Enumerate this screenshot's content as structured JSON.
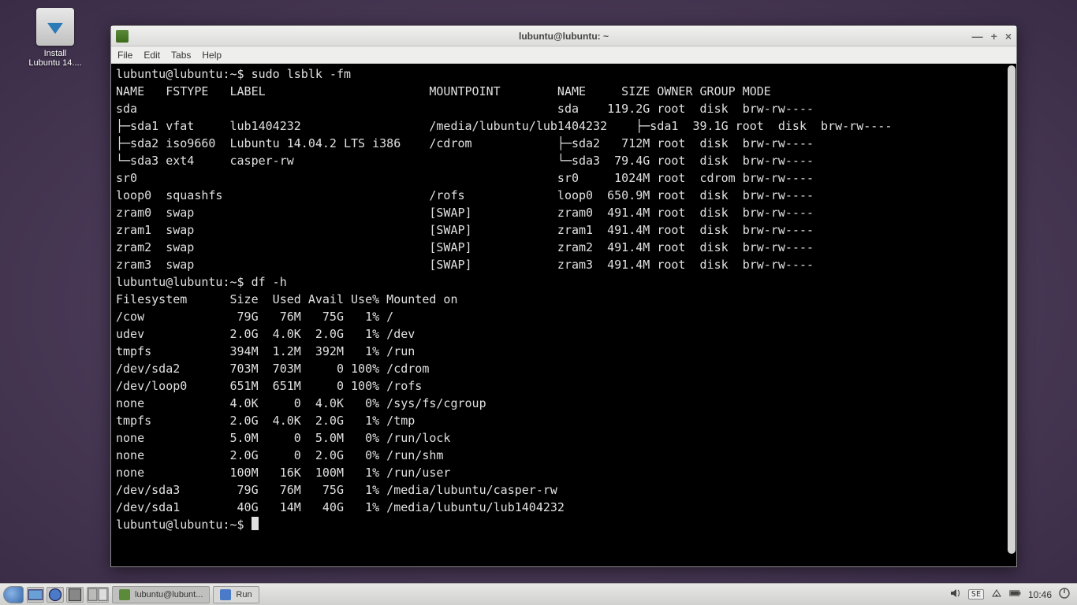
{
  "desktop_icon": {
    "label": "Install\nLubuntu 14...."
  },
  "window": {
    "title": "lubuntu@lubuntu: ~",
    "menus": [
      "File",
      "Edit",
      "Tabs",
      "Help"
    ]
  },
  "terminal": {
    "prompt": "lubuntu@lubuntu:~$",
    "cmd1": "sudo lsblk -fm",
    "lsblk_header_left": "NAME   FSTYPE   LABEL                       MOUNTPOINT",
    "lsblk_header_right": "NAME     SIZE OWNER GROUP MODE",
    "lsblk_rows": [
      {
        "l": "sda",
        "r": "sda    119.2G root  disk  brw-rw----"
      },
      {
        "l": "├─sda1 vfat     lub1404232                  /media/lubuntu/lub1404232",
        "r": "├─sda1  39.1G root  disk  brw-rw----"
      },
      {
        "l": "├─sda2 iso9660  Lubuntu 14.04.2 LTS i386    /cdrom",
        "r": "├─sda2   712M root  disk  brw-rw----"
      },
      {
        "l": "└─sda3 ext4     casper-rw",
        "r": "└─sda3  79.4G root  disk  brw-rw----"
      },
      {
        "l": "sr0",
        "r": "sr0     1024M root  cdrom brw-rw----"
      },
      {
        "l": "loop0  squashfs                             /rofs",
        "r": "loop0  650.9M root  disk  brw-rw----"
      },
      {
        "l": "zram0  swap                                 [SWAP]",
        "r": "zram0  491.4M root  disk  brw-rw----"
      },
      {
        "l": "zram1  swap                                 [SWAP]",
        "r": "zram1  491.4M root  disk  brw-rw----"
      },
      {
        "l": "zram2  swap                                 [SWAP]",
        "r": "zram2  491.4M root  disk  brw-rw----"
      },
      {
        "l": "zram3  swap                                 [SWAP]",
        "r": "zram3  491.4M root  disk  brw-rw----"
      }
    ],
    "cmd2": "df -h",
    "df_header": "Filesystem      Size  Used Avail Use% Mounted on",
    "df_rows": [
      "/cow             79G   76M   75G   1% /",
      "udev            2.0G  4.0K  2.0G   1% /dev",
      "tmpfs           394M  1.2M  392M   1% /run",
      "/dev/sda2       703M  703M     0 100% /cdrom",
      "/dev/loop0      651M  651M     0 100% /rofs",
      "none            4.0K     0  4.0K   0% /sys/fs/cgroup",
      "tmpfs           2.0G  4.0K  2.0G   1% /tmp",
      "none            5.0M     0  5.0M   0% /run/lock",
      "none            2.0G     0  2.0G   0% /run/shm",
      "none            100M   16K  100M   1% /run/user",
      "/dev/sda3        79G   76M   75G   1% /media/lubuntu/casper-rw",
      "/dev/sda1        40G   14M   40G   1% /media/lubuntu/lub1404232"
    ]
  },
  "taskbar": {
    "tasks": [
      {
        "label": "lubuntu@lubunt...",
        "active": true,
        "icon": "term"
      },
      {
        "label": "Run",
        "active": false,
        "icon": "run"
      }
    ],
    "keyboard_indicator": "SE",
    "clock": "10:46"
  }
}
